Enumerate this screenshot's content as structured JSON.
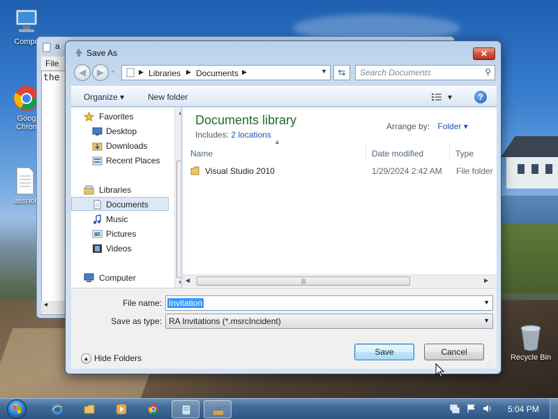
{
  "desktop": {
    "icons": [
      {
        "label": "Compu"
      },
      {
        "label": "Goog\nChron"
      },
      {
        "label": "asshol"
      },
      {
        "label": "Recycle Bin"
      }
    ]
  },
  "notepad": {
    "title": "a",
    "menu_file": "File",
    "body_text": "the",
    "scroll_arrow": "◂"
  },
  "dialog": {
    "title": "Save As",
    "close_label": "✕",
    "address": [
      "Libraries",
      "Documents"
    ],
    "search_placeholder": "Search Documents",
    "toolbar": {
      "organize": "Organize ▾",
      "new_folder": "New folder",
      "views": "▾",
      "help": "?"
    },
    "nav": {
      "favorites": "Favorites",
      "desktop": "Desktop",
      "downloads": "Downloads",
      "recent_places": "Recent Places",
      "libraries": "Libraries",
      "documents": "Documents",
      "music": "Music",
      "pictures": "Pictures",
      "videos": "Videos",
      "computer": "Computer"
    },
    "library": {
      "title": "Documents library",
      "includes_prefix": "Includes: ",
      "includes_link": "2 locations",
      "arrange_by_label": "Arrange by:",
      "arrange_by_value": "Folder ▾"
    },
    "columns": [
      "Name",
      "Date modified",
      "Type"
    ],
    "rows": [
      {
        "name": "Visual Studio 2010",
        "date": "1/29/2024 2:42 AM",
        "type": "File folder"
      }
    ],
    "file_name_label": "File name:",
    "file_name_value": "Invitation",
    "save_type_label": "Save as type:",
    "save_type_value": "RA Invitations (*.msrcIncident)",
    "hide_folders": "Hide Folders",
    "save_button": "Save",
    "cancel_button": "Cancel"
  },
  "taskbar": {
    "clock": "5:04 PM"
  },
  "colors": {
    "library_title": "#1c6d2c",
    "link": "#1a56b3",
    "selection": "#3399ff"
  }
}
